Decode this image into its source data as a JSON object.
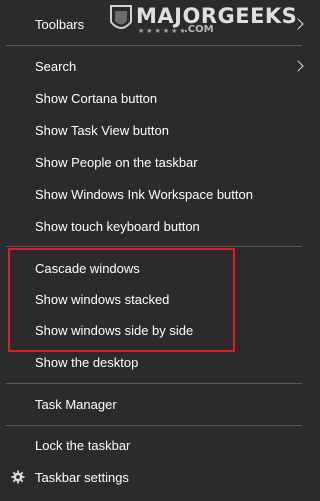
{
  "menu": {
    "items": [
      {
        "label": "Toolbars",
        "has_submenu": true
      },
      {
        "label": "Search",
        "has_submenu": true
      },
      {
        "label": "Show Cortana button"
      },
      {
        "label": "Show Task View button"
      },
      {
        "label": "Show People on the taskbar"
      },
      {
        "label": "Show Windows Ink Workspace button"
      },
      {
        "label": "Show touch keyboard button"
      },
      {
        "label": "Cascade windows"
      },
      {
        "label": "Show windows stacked"
      },
      {
        "label": "Show windows side by side"
      },
      {
        "label": "Show the desktop"
      },
      {
        "label": "Task Manager"
      },
      {
        "label": "Lock the taskbar"
      },
      {
        "label": "Taskbar settings",
        "icon": "gear-icon"
      }
    ]
  },
  "watermark": {
    "main": "MAJORGEEKS",
    "sub": ".COM"
  },
  "colors": {
    "background": "#2b2b2b",
    "text": "#ffffff",
    "separator": "#5a5a5a",
    "highlight_box": "#e01b24"
  }
}
